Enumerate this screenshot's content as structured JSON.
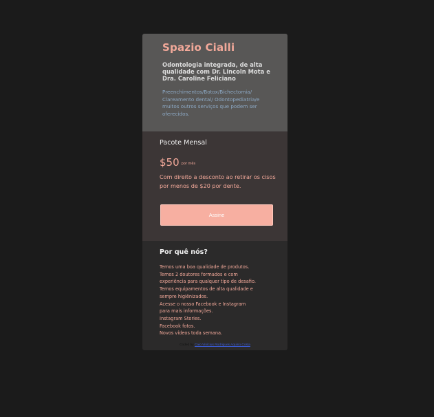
{
  "header": {
    "brand": "Spazio Cialli",
    "subtitle": "Odontologia integrada, de alta qualidade com Dr. Lincoln Mota e Dra. Caroline Feliciano",
    "services": "Preenchimentos/Botox/Bichectomia/ Clareamento dental/ Odontopediatria/e muitos outros serviços que podem ser oferecidos."
  },
  "plan": {
    "title": "Pacote Mensal",
    "price": "$50",
    "price_unit": "por mês",
    "description": "Com direito a desconto ao retirar os cisos por menos de $20 por dente.",
    "button_label": "Assine"
  },
  "why": {
    "title": "Por quê nós?",
    "lines": [
      "Temos uma boa qualidade de produtos.",
      "Temos 2 doutores formados e com",
      "experiência para qualquer tipo de desafio.",
      "Temos equipamentos de alta qualidade e",
      "sempre higiênizados.",
      "Acesse o nosso Facebook e Instagram",
      "para mais informações.",
      "Instagram Stories.",
      "Facebook fotos.",
      "Novos vídeos toda semana."
    ]
  },
  "footer": {
    "prefix": "Coded by",
    "author": "Caio Vinícius Rodrigues Aquino Costa"
  },
  "colors": {
    "background": "#1b1b1b",
    "accent": "#f3a99a",
    "button": "#f7afa1",
    "link": "#3b5bd6"
  }
}
